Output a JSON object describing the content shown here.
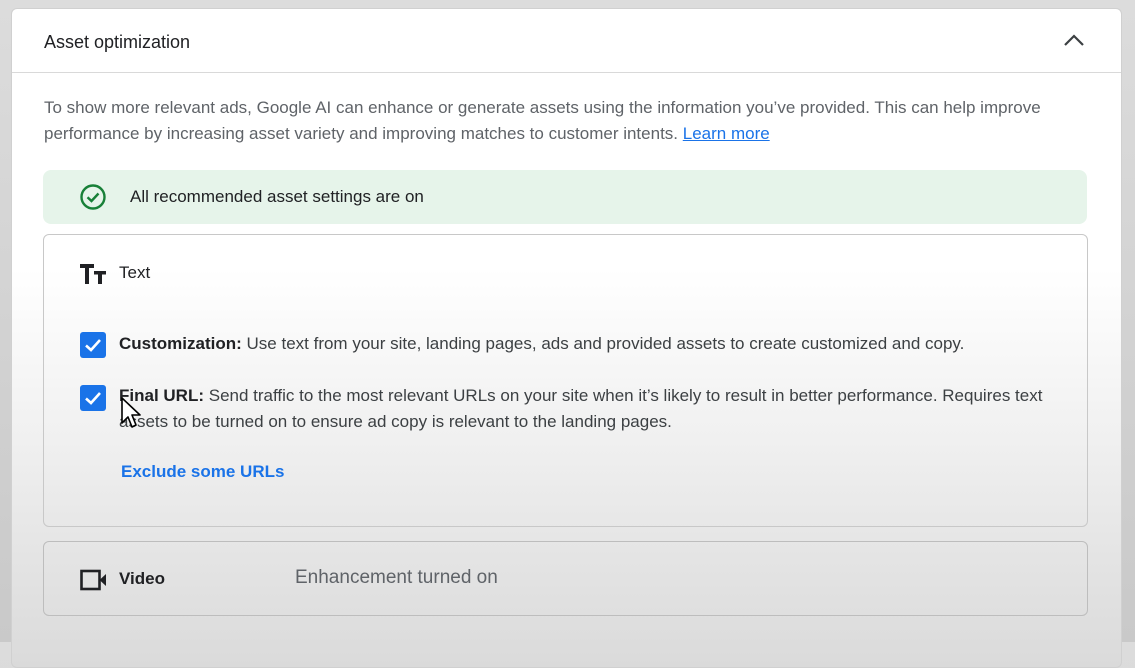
{
  "panel": {
    "title": "Asset optimization",
    "description": "To show more relevant ads, Google AI can enhance or generate assets using the information you’ve provided. This can help improve performance by increasing asset variety and improving matches to customer intents.",
    "learn_more": "Learn more"
  },
  "banner": {
    "text": "All recommended asset settings are on",
    "icon": "check-circle-icon",
    "color": "#e6f4ea"
  },
  "text_card": {
    "title": "Text",
    "icon": "text-fields-icon",
    "options": [
      {
        "label": "Customization:",
        "description": "Use text from your site, landing pages, ads and provided assets to create customized and copy.",
        "checked": true
      },
      {
        "label": "Final URL:",
        "description": "Send traffic to the most relevant URLs on your site when it’s likely to result in better performance. Requires text assets to be turned on to ensure ad copy is relevant to the landing pages.",
        "checked": true
      }
    ],
    "exclude_link": "Exclude some URLs"
  },
  "video_card": {
    "title": "Video",
    "icon": "video-camera-icon",
    "status": "Enhancement turned on"
  },
  "colors": {
    "accent": "#1a73e8",
    "success": "#188038"
  }
}
